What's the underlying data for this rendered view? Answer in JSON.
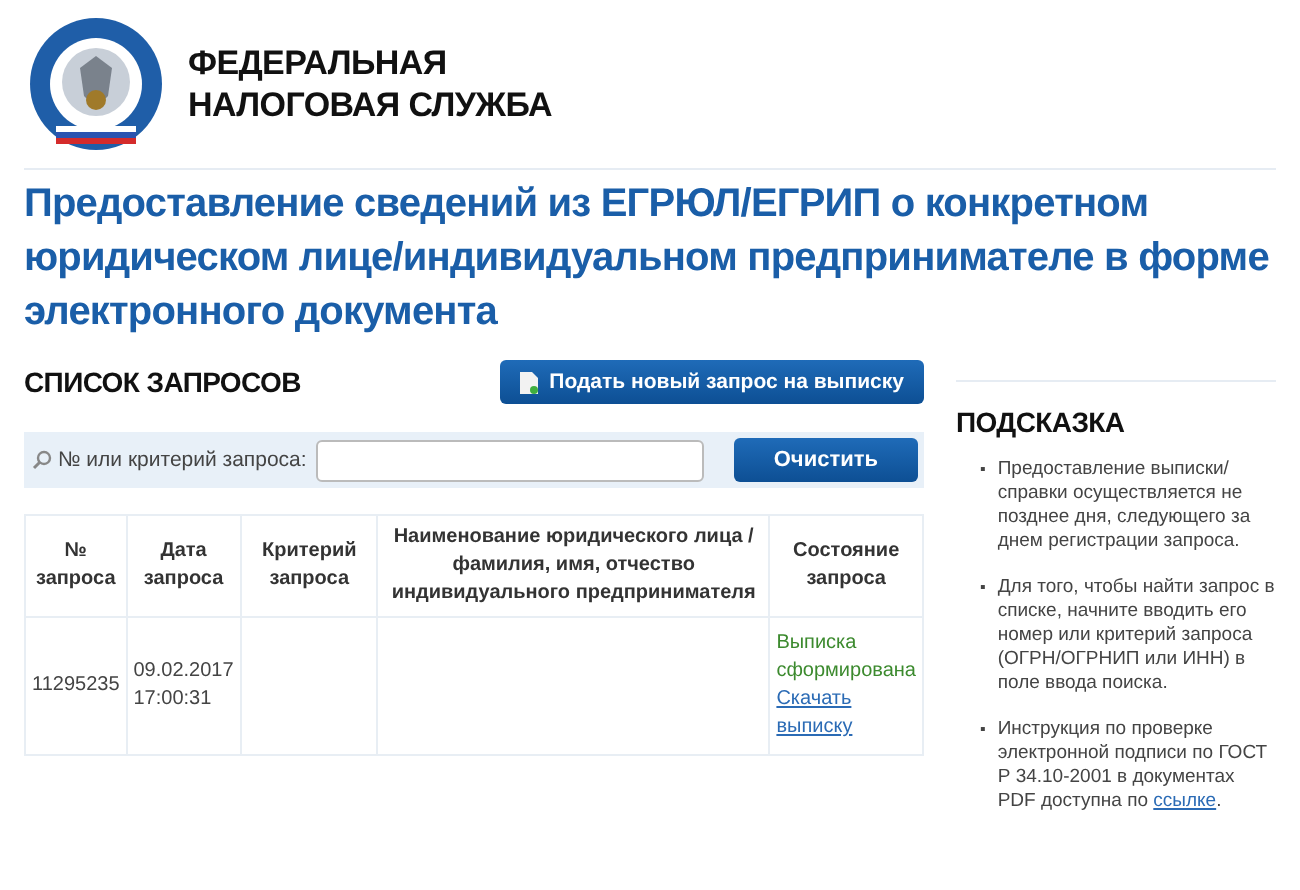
{
  "header": {
    "org_name_lines": [
      "ФЕДЕРАЛЬНАЯ",
      "НАЛОГОВАЯ СЛУЖБА"
    ]
  },
  "title": "Предоставление сведений из ЕГРЮЛ/ЕГРИП о конкретном юридическом лице/индивидуальном предпринимателе в форме электронного документа",
  "requests": {
    "heading": "СПИСОК ЗАПРОСОВ",
    "new_request_button": "Подать новый запрос на выписку",
    "search": {
      "label": "№ или критерий запроса:",
      "clear_button": "Очистить"
    },
    "table": {
      "columns": [
        "№ запроса",
        "Дата запроса",
        "Критерий запроса",
        "Наименование юридического лица / фамилия, имя, отчество индивидуального предпринимателя",
        "Состояние запроса"
      ],
      "rows": [
        {
          "number": "11295235",
          "date": "09.02.2017",
          "time": "17:00:31",
          "status": "Выписка сформирована",
          "download_link": "Скачать выписку"
        }
      ]
    }
  },
  "hint": {
    "heading": "ПОДСКАЗКА",
    "items": [
      {
        "marker": "▪",
        "text": "Предоставление выписки/ справки осуществляется не позднее дня, следующего за днем регистрации запроса."
      },
      {
        "marker": "▪",
        "text": "Для того, чтобы найти запрос в списке, начните вводить его номер или критерий запроса (ОГРН/ОГРНИП или ИНН) в поле ввода поиска."
      },
      {
        "marker": "▪",
        "text": "Инструкция по проверке электронной подписи по ГОСТ Р 34.10-2001 в документах PDF доступна по ",
        "link": "ссылке",
        "tail": "."
      }
    ]
  }
}
